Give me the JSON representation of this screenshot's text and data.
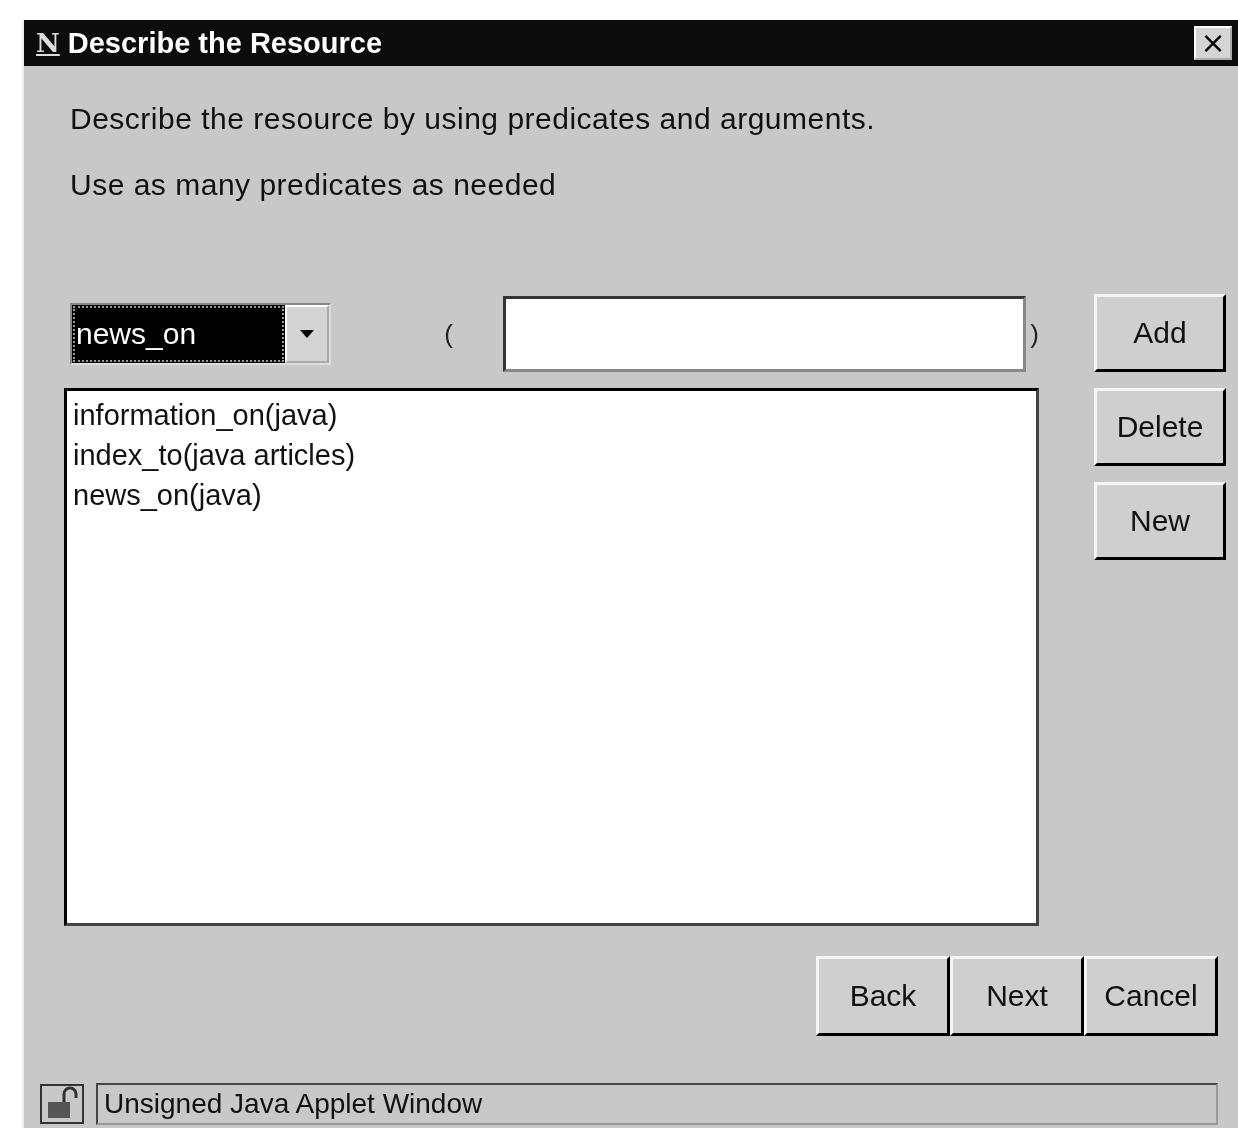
{
  "window": {
    "logo": "N",
    "title": "Describe the Resource",
    "close": "×"
  },
  "instructions": [
    "Describe the resource by using predicates and arguments.",
    "Use as many predicates as needed"
  ],
  "predicate_select": {
    "value": "news_on"
  },
  "open_paren": "(",
  "close_paren": ")",
  "side_buttons": [
    "Add",
    "Delete",
    "New"
  ],
  "predicate_list": [
    {
      "text": "information_on(java)",
      "selected": false
    },
    {
      "text": "index_to(java articles)",
      "selected": false
    },
    {
      "text": "news_on(java)",
      "selected": false
    }
  ],
  "nav_buttons": [
    "Back",
    "Next",
    "Cancel"
  ],
  "status_bar": {
    "text": "Unsigned Java Applet Window"
  }
}
